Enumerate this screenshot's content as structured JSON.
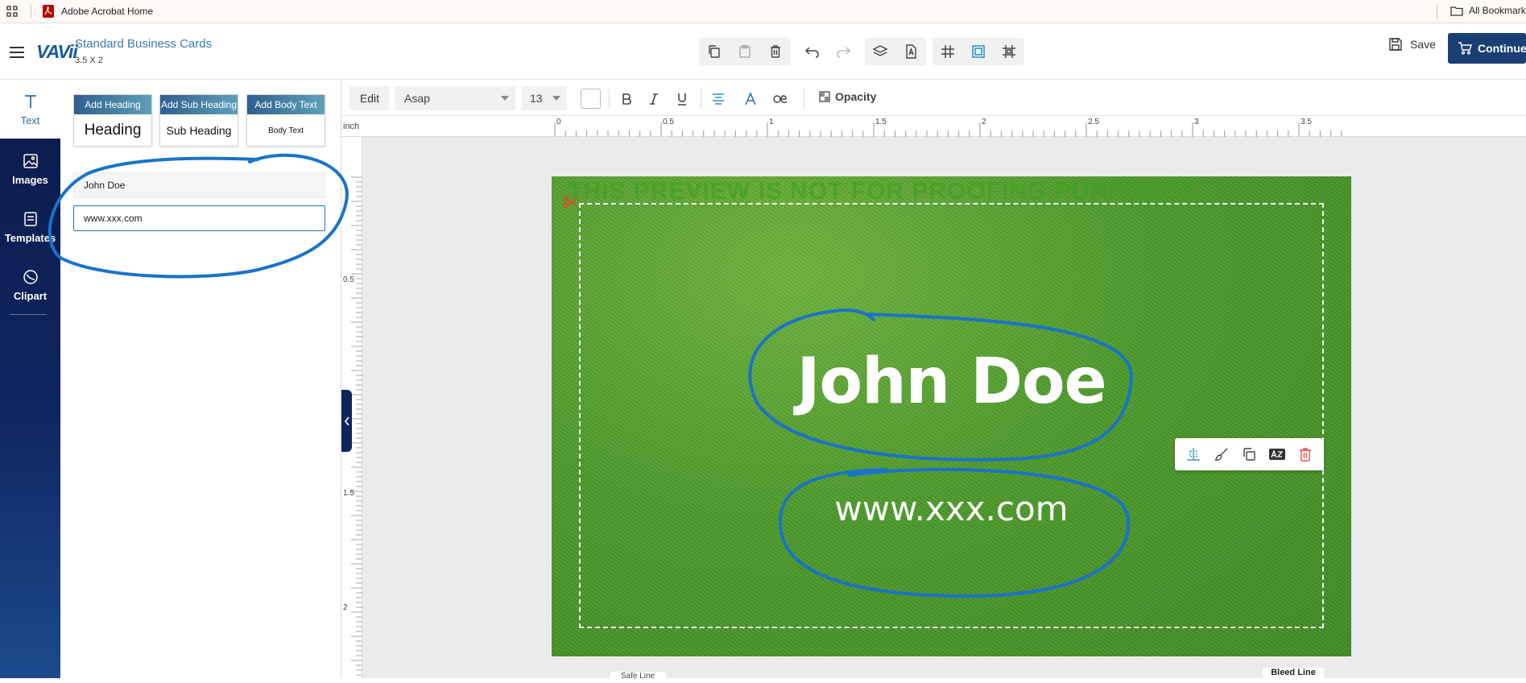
{
  "browser": {
    "bookmark_acrobat": "Adobe Acrobat Home",
    "bookmark_all": "All Bookmarks"
  },
  "header": {
    "logo": "VAVii",
    "doc_title": "Standard Business Cards",
    "doc_size": "3.5 X 2",
    "save_label": "Save",
    "continue_label": "Continue"
  },
  "rail": {
    "items": [
      {
        "label": "Text",
        "icon": "text-icon"
      },
      {
        "label": "Images",
        "icon": "image-icon"
      },
      {
        "label": "Templates",
        "icon": "templates-icon"
      },
      {
        "label": "Clipart",
        "icon": "clipart-icon"
      }
    ]
  },
  "panel": {
    "add_heading": {
      "button": "Add Heading",
      "sample": "Heading"
    },
    "add_subheading": {
      "button": "Add Sub Heading",
      "sample": "Sub Heading"
    },
    "add_body": {
      "button": "Add Body Text",
      "sample": "Body Text"
    },
    "text_items": [
      "John Doe",
      "www.xxx.com"
    ]
  },
  "format_toolbar": {
    "edit_label": "Edit",
    "font": "Asap",
    "size": "13",
    "opacity_label": "Opacity"
  },
  "ruler": {
    "unit": "inch",
    "h_ticks": [
      "0",
      "0.5",
      "1",
      "1.5",
      "2",
      "2.5",
      "3",
      "3.5"
    ],
    "v_ticks": [
      "0.5",
      "1.5",
      "2"
    ]
  },
  "card": {
    "watermark": "THIS PREVIEW IS NOT FOR PROOFING PURPOSES",
    "name": "John Doe",
    "website": "www.xxx.com",
    "bleed_label": "Bleed Line",
    "safe_label": "Safe Line"
  },
  "colors": {
    "brand_dark": "#1a3f73",
    "accent": "#2a6fa8",
    "annotation": "#1a73c8"
  }
}
